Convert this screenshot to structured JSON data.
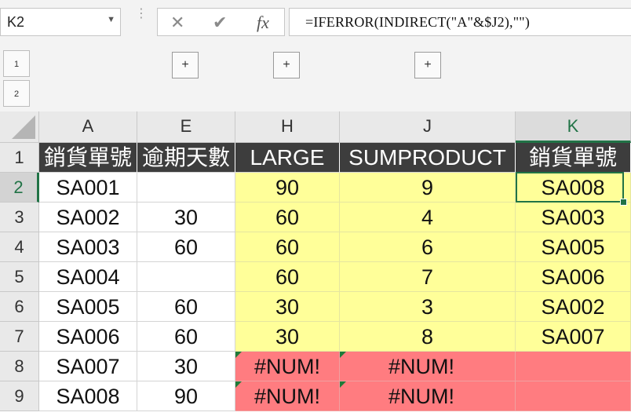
{
  "formula_bar": {
    "name_box": "K2",
    "name_box_dropdown_icon": "dropdown-arrow-icon",
    "cancel_icon": "✕",
    "enter_icon": "✔",
    "fx_icon": "fx",
    "formula": "=IFERROR(INDIRECT(\"A\"&$J2),\"\")"
  },
  "outline": {
    "levels": [
      "1",
      "2"
    ],
    "expand_symbol": "+"
  },
  "columns": [
    {
      "id": "A",
      "header": "A",
      "selected": false
    },
    {
      "id": "E",
      "header": "E",
      "selected": false
    },
    {
      "id": "H",
      "header": "H",
      "selected": false
    },
    {
      "id": "J",
      "header": "J",
      "selected": false
    },
    {
      "id": "K",
      "header": "K",
      "selected": true
    }
  ],
  "rows": [
    {
      "num": "1",
      "A": "銷貨單號",
      "E": "逾期天數",
      "H": "LARGE",
      "J": "SUMPRODUCT",
      "K": "銷貨單號"
    },
    {
      "num": "2",
      "A": "SA001",
      "E": "",
      "H": "90",
      "J": "9",
      "K": "SA008"
    },
    {
      "num": "3",
      "A": "SA002",
      "E": "30",
      "H": "60",
      "J": "4",
      "K": "SA003"
    },
    {
      "num": "4",
      "A": "SA003",
      "E": "60",
      "H": "60",
      "J": "6",
      "K": "SA005"
    },
    {
      "num": "5",
      "A": "SA004",
      "E": "",
      "H": "60",
      "J": "7",
      "K": "SA006"
    },
    {
      "num": "6",
      "A": "SA005",
      "E": "60",
      "H": "30",
      "J": "3",
      "K": "SA002"
    },
    {
      "num": "7",
      "A": "SA006",
      "E": "60",
      "H": "30",
      "J": "8",
      "K": "SA007"
    },
    {
      "num": "8",
      "A": "SA007",
      "E": "30",
      "H": "#NUM!",
      "J": "#NUM!",
      "K": ""
    },
    {
      "num": "9",
      "A": "SA008",
      "E": "90",
      "H": "#NUM!",
      "J": "#NUM!",
      "K": ""
    }
  ],
  "colors": {
    "header_fill": "#3d3d3d",
    "highlight_yellow": "#ffff99",
    "error_red": "#ff7c80",
    "selection_green": "#217346"
  },
  "active_cell": "K2"
}
